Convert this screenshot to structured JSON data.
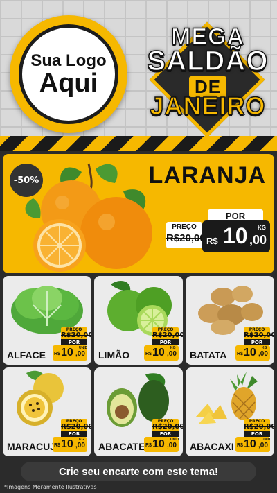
{
  "logo": {
    "line1": "Sua Logo",
    "line2": "Aqui"
  },
  "sale": {
    "line1": "MEGA",
    "line2": "SALDÃO",
    "line3": "DE",
    "line4": "JANEIRO"
  },
  "hero": {
    "discount": "-50%",
    "name": "LARANJA",
    "por": "POR",
    "preco_label": "PREÇO",
    "old_price": "R$20,00",
    "currency": "R$",
    "price_int": "10",
    "price_dec": ",00",
    "unit": "KG"
  },
  "products": [
    {
      "name": "ALFACE",
      "preco": "PREÇO",
      "old": "R$20,00",
      "por": "POR",
      "cur": "R$",
      "int": "10",
      "dec": ",00",
      "unit": "UNID"
    },
    {
      "name": "LIMÃO",
      "preco": "PREÇO",
      "old": "R$20,00",
      "por": "POR",
      "cur": "R$",
      "int": "10",
      "dec": ",00",
      "unit": "KG"
    },
    {
      "name": "BATATA",
      "preco": "PREÇO",
      "old": "R$20,00",
      "por": "POR",
      "cur": "R$",
      "int": "10",
      "dec": ",00",
      "unit": "KG"
    },
    {
      "name": "MARACUJÁ",
      "preco": "PREÇO",
      "old": "R$20,00",
      "por": "POR",
      "cur": "R$",
      "int": "10",
      "dec": ",00",
      "unit": "KG"
    },
    {
      "name": "ABACATE",
      "preco": "PREÇO",
      "old": "R$20,00",
      "por": "POR",
      "cur": "R$",
      "int": "10",
      "dec": ",00",
      "unit": "UNID"
    },
    {
      "name": "ABACAXI",
      "preco": "PREÇO",
      "old": "R$20,00",
      "por": "POR",
      "cur": "R$",
      "int": "10",
      "dec": ",00",
      "unit": "UNID"
    }
  ],
  "footer": {
    "cta": "Crie seu encarte com este tema!",
    "disclaimer": "*Imagens Meramente Ilustrativas"
  },
  "colors": {
    "accent": "#f6b800",
    "dark": "#1a1a1a",
    "card": "#ebebeb"
  }
}
